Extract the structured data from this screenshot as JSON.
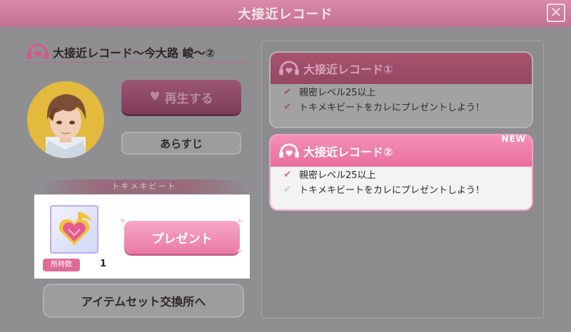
{
  "dialog": {
    "title": "大接近レコード",
    "close_label": "✕"
  },
  "record": {
    "title": "大接近レコード～今大路 峻～②"
  },
  "buttons": {
    "play_label": "再生する",
    "synopsis_label": "あらすじ",
    "present_label": "プレゼント",
    "exchange_label": "アイテムセット交換所へ"
  },
  "tokimeki": {
    "label": "トキメキビート",
    "owned_label": "所持数",
    "owned_count": "1"
  },
  "records": [
    {
      "title": "大接近レコード①",
      "conditions": [
        {
          "text": "親密レベル25以上",
          "met": true
        },
        {
          "text": "トキメキビートをカレにプレゼントしよう！",
          "met": true
        }
      ]
    },
    {
      "title": "大接近レコード②",
      "badge": "NEW",
      "conditions": [
        {
          "text": "親密レベル25以上",
          "met": true
        },
        {
          "text": "トキメキビートをカレにプレゼントしよう！",
          "met": false
        }
      ]
    }
  ],
  "icons": {
    "check": "check-icon",
    "heart": "heart-icon",
    "headphone": "headphone-heart-icon",
    "close": "close-icon"
  },
  "colors": {
    "accent_pink": "#e86f9e",
    "title_bar": "#c2718f",
    "avatar_bg": "#e3b93e"
  }
}
